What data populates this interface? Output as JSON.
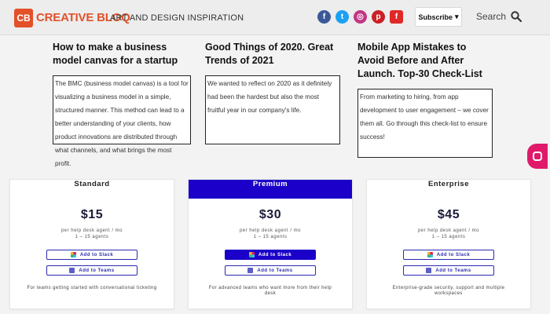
{
  "header": {
    "logo_mark": "CB",
    "logo_text": "CREATIVE BLOQ",
    "tagline": "ART AND DESIGN INSPIRATION",
    "social": [
      {
        "name": "facebook",
        "glyph": "f",
        "color": "#3b5998"
      },
      {
        "name": "twitter",
        "glyph": "t",
        "color": "#1da1f2"
      },
      {
        "name": "instagram",
        "glyph": "◎",
        "color": "#c13584"
      },
      {
        "name": "pinterest",
        "glyph": "p",
        "color": "#cb2027"
      },
      {
        "name": "flipboard",
        "glyph": "f",
        "color": "#e12828"
      }
    ],
    "subscribe_label": "Subscribe",
    "subscribe_caret": "▾",
    "search_label": "Search"
  },
  "articles": [
    {
      "title": "How to make a business model canvas for a startup",
      "excerpt": "The BMC (business model canvas) is a tool for visualizing a business model in a simple, structured manner. This method can lead to a better understanding of your clients, how product innovations are distributed through what channels, and what brings the most profit."
    },
    {
      "title": "Good Things of 2020. Great Trends of 2021",
      "excerpt": "We wanted to reflect on 2020 as it definitely had been the hardest but also the most fruitful year in our company's life."
    },
    {
      "title": "Mobile App Mistakes to Avoid Before and After Launch. Top-30 Check-List",
      "excerpt": "From marketing to hiring, from app development to user engagement – we cover them all. Go through this check-list to ensure success!"
    }
  ],
  "plans": [
    {
      "name": "Standard",
      "price": "$15",
      "unit": "per help desk agent / mo",
      "agents": "1 – 15 agents",
      "slack_label": "Add to Slack",
      "teams_label": "Add to Teams",
      "footnote": "For teams getting started with conversational ticketing"
    },
    {
      "name": "Premium",
      "price": "$30",
      "unit": "per help desk agent / mo",
      "agents": "1 – 15 agents",
      "slack_label": "Add to Slack",
      "teams_label": "Add to Teams",
      "footnote": "For advanced teams who want more from their help desk"
    },
    {
      "name": "Enterprise",
      "price": "$45",
      "unit": "per help desk agent / mo",
      "agents": "1 – 15 agents",
      "slack_label": "Add to Slack",
      "teams_label": "Add to Teams",
      "footnote": "Enterprise-grade security, support and multiple workspaces"
    }
  ],
  "colors": {
    "brand": "#e2512a",
    "premium": "#1a00c8",
    "chat": "#e01a6b"
  }
}
